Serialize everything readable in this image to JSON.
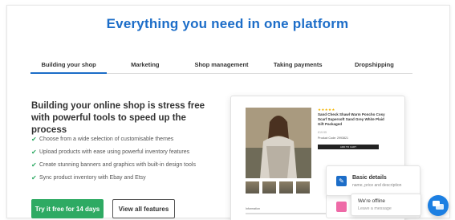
{
  "headline": "Everything you need in one platform",
  "tabs": [
    {
      "label": "Building your shop",
      "active": true
    },
    {
      "label": "Marketing",
      "active": false
    },
    {
      "label": "Shop management",
      "active": false
    },
    {
      "label": "Taking payments",
      "active": false
    },
    {
      "label": "Dropshipping",
      "active": false
    }
  ],
  "section": {
    "title": "Building your online shop is stress free with powerful tools to speed up the process",
    "features": [
      "Choose from a wide selection of customisable themes",
      "Upload products with ease using powerful inventory features",
      "Create stunning banners and graphics with built-in design tools",
      "Sync product inventory with Ebay and Etsy"
    ],
    "cta_primary": "Try it free for 14 days",
    "cta_secondary": "View all features"
  },
  "mockup": {
    "stars": "★★★★★",
    "product_title": "Sand Check Shawl Warm Poncho Cosy Scarf Supersoft Sand Grey White Plaid Gift Packaged",
    "price": "£19.95",
    "product_code": "Product Code: 2993821",
    "add_to_cart": "ADD TO CART",
    "info_label": "Information"
  },
  "basic_details": {
    "title": "Basic details",
    "subtitle": "name, price and description"
  },
  "chat": {
    "status": "We're offline",
    "prompt": "Leave a message"
  },
  "colors": {
    "accent_blue": "#1c6dc8",
    "cta_green": "#2eaa63",
    "star_yellow": "#f3b400",
    "chat_blue": "#1c7fe2"
  },
  "icons": {
    "feature_bullet": "check-icon",
    "basic_details": "edit-icon",
    "chat_fab": "chat-icon"
  }
}
